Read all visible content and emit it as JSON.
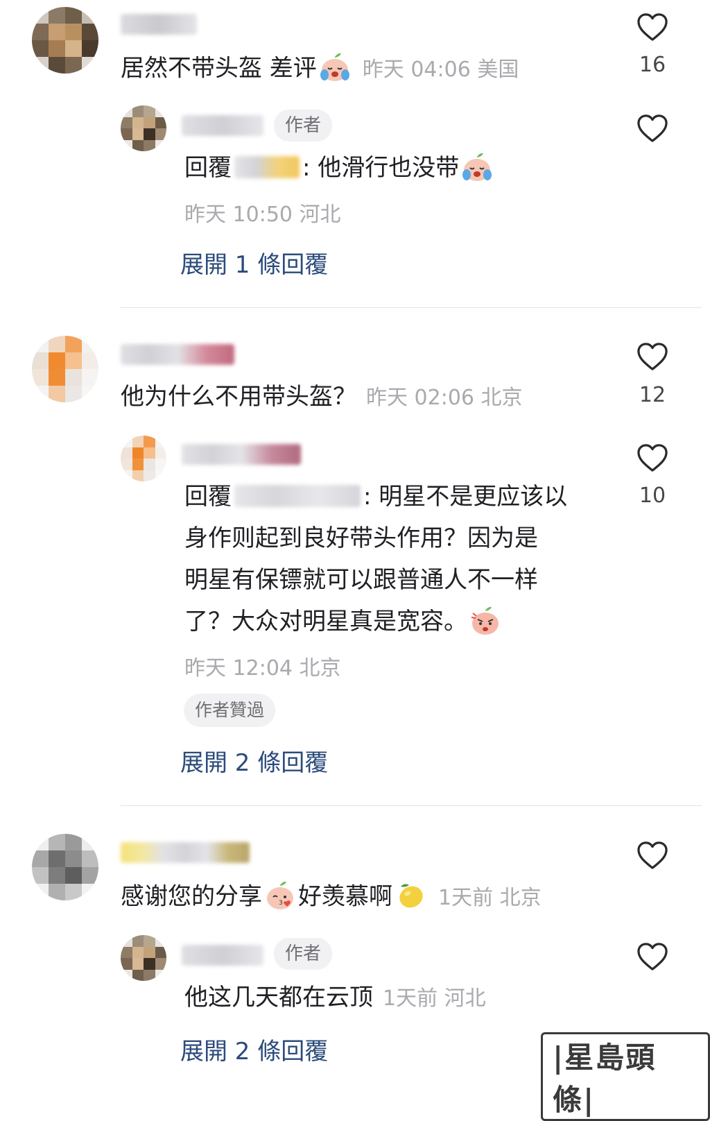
{
  "comments": [
    {
      "text": "居然不带头盔 差评",
      "meta": "昨天 04:06 美国",
      "likes": "16",
      "reply": {
        "author_tag": "作者",
        "prefix": "回覆",
        "text": ": 他滑行也没带",
        "meta": "昨天 10:50 河北"
      },
      "expand": "展開 1 條回覆"
    },
    {
      "text": "他为什么不用带头盔？",
      "meta": "昨天 02:06 北京",
      "likes": "12",
      "reply": {
        "prefix": "回覆",
        "line1": ": 明星不是更应该以",
        "line2": "身作则起到良好带头作用？因为是",
        "line3": "明星有保镖就可以跟普通人不一样",
        "line4": "了？大众对明星真是宽容。",
        "meta": "昨天 12:04 北京",
        "likes": "10",
        "liked_tag": "作者贊過"
      },
      "expand": "展開 2 條回覆"
    },
    {
      "text1": "感谢您的分享",
      "text2": "好羡慕啊",
      "meta": "1天前 北京",
      "reply": {
        "author_tag": "作者",
        "text": "他这几天都在云顶",
        "meta": "1天前 河北"
      },
      "expand": "展開 2 條回覆"
    }
  ],
  "watermark": "|星島頭條|",
  "icons": {
    "like": "heart-outline-icon",
    "emoji_cry": "crying-peach-emoji-icon",
    "emoji_angry": "angry-peach-emoji-icon",
    "emoji_kiss": "kiss-peach-emoji-icon",
    "emoji_lemon": "lemon-emoji-icon"
  },
  "colors": {
    "text": "#1f1f24",
    "meta": "#a9a9ae",
    "link": "#2b4b7b",
    "tag_bg": "#f1f1f3"
  }
}
